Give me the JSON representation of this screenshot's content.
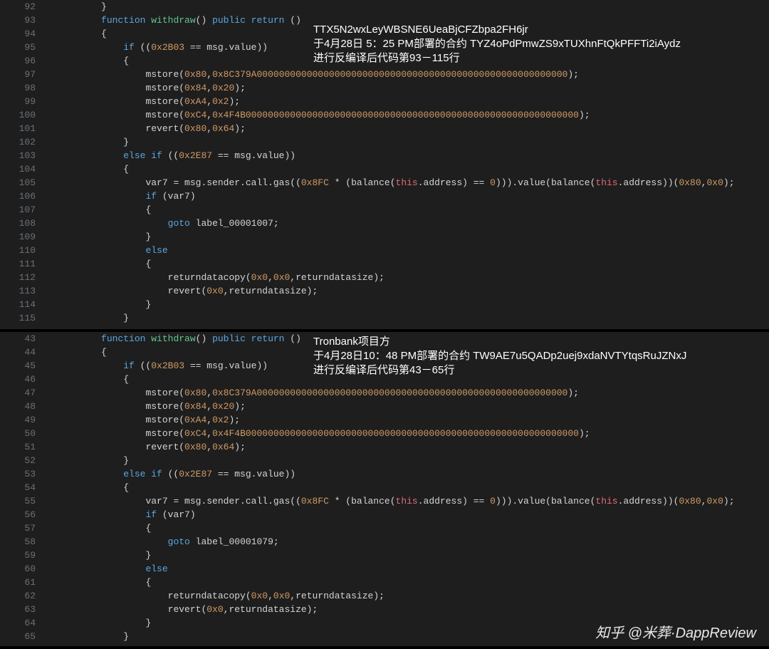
{
  "panel1": {
    "callout": {
      "line1": "TTX5N2wxLeyWBSNE6UeaBjCFZbpa2FH6jr",
      "line2": "于4月28日 5：25 PM部署的合约 TYZ4oPdPmwZS9xTUXhnFtQkPFFTi2iAydz",
      "line3": "进行反编译后代码第93－115行"
    },
    "start": 92,
    "lines": [
      {
        "n": 92,
        "i": 2,
        "t": [
          [
            "txt",
            "}"
          ]
        ]
      },
      {
        "n": 93,
        "i": 2,
        "t": [
          [
            "kw",
            "function "
          ],
          [
            "fn",
            "withdraw"
          ],
          [
            "txt",
            "() "
          ],
          [
            "kw",
            "public return"
          ],
          [
            "txt",
            " ()"
          ]
        ]
      },
      {
        "n": 94,
        "i": 2,
        "t": [
          [
            "txt",
            "{"
          ]
        ]
      },
      {
        "n": 95,
        "i": 3,
        "t": [
          [
            "kw",
            "if"
          ],
          [
            "txt",
            " (("
          ],
          [
            "num",
            "0x2B03"
          ],
          [
            "txt",
            " == msg.value))"
          ]
        ]
      },
      {
        "n": 96,
        "i": 3,
        "t": [
          [
            "txt",
            "{"
          ]
        ]
      },
      {
        "n": 97,
        "i": 4,
        "t": [
          [
            "txt",
            "mstore("
          ],
          [
            "num",
            "0x80"
          ],
          [
            "txt",
            ","
          ],
          [
            "num",
            "0x8C379A00000000000000000000000000000000000000000000000000000000"
          ],
          [
            "txt",
            ");"
          ]
        ]
      },
      {
        "n": 98,
        "i": 4,
        "t": [
          [
            "txt",
            "mstore("
          ],
          [
            "num",
            "0x84"
          ],
          [
            "txt",
            ","
          ],
          [
            "num",
            "0x20"
          ],
          [
            "txt",
            ");"
          ]
        ]
      },
      {
        "n": 99,
        "i": 4,
        "t": [
          [
            "txt",
            "mstore("
          ],
          [
            "num",
            "0xA4"
          ],
          [
            "txt",
            ","
          ],
          [
            "num",
            "0x2"
          ],
          [
            "txt",
            ");"
          ]
        ]
      },
      {
        "n": 100,
        "i": 4,
        "t": [
          [
            "txt",
            "mstore("
          ],
          [
            "num",
            "0xC4"
          ],
          [
            "txt",
            ","
          ],
          [
            "num",
            "0x4F4B000000000000000000000000000000000000000000000000000000000000"
          ],
          [
            "txt",
            ");"
          ]
        ]
      },
      {
        "n": 101,
        "i": 4,
        "t": [
          [
            "txt",
            "revert("
          ],
          [
            "num",
            "0x80"
          ],
          [
            "txt",
            ","
          ],
          [
            "num",
            "0x64"
          ],
          [
            "txt",
            ");"
          ]
        ]
      },
      {
        "n": 102,
        "i": 3,
        "t": [
          [
            "txt",
            "}"
          ]
        ]
      },
      {
        "n": 103,
        "i": 3,
        "t": [
          [
            "kw",
            "else if"
          ],
          [
            "txt",
            " (("
          ],
          [
            "num",
            "0x2E87"
          ],
          [
            "txt",
            " == msg.value))"
          ]
        ]
      },
      {
        "n": 104,
        "i": 3,
        "t": [
          [
            "txt",
            "{"
          ]
        ]
      },
      {
        "n": 105,
        "i": 4,
        "t": [
          [
            "txt",
            "var7 = msg.sender.call.gas(("
          ],
          [
            "num",
            "0x8FC"
          ],
          [
            "txt",
            " * (balance("
          ],
          [
            "prop",
            "this"
          ],
          [
            "txt",
            ".address) == "
          ],
          [
            "num",
            "0"
          ],
          [
            "txt",
            "))).value(balance("
          ],
          [
            "prop",
            "this"
          ],
          [
            "txt",
            ".address))("
          ],
          [
            "num",
            "0x80"
          ],
          [
            "txt",
            ","
          ],
          [
            "num",
            "0x0"
          ],
          [
            "txt",
            ");"
          ]
        ]
      },
      {
        "n": 106,
        "i": 4,
        "t": [
          [
            "kw",
            "if"
          ],
          [
            "txt",
            " (var7)"
          ]
        ]
      },
      {
        "n": 107,
        "i": 4,
        "t": [
          [
            "txt",
            "{"
          ]
        ]
      },
      {
        "n": 108,
        "i": 5,
        "t": [
          [
            "kw",
            "goto"
          ],
          [
            "txt",
            " label_00001007;"
          ]
        ]
      },
      {
        "n": 109,
        "i": 4,
        "t": [
          [
            "txt",
            "}"
          ]
        ]
      },
      {
        "n": 110,
        "i": 4,
        "t": [
          [
            "kw",
            "else"
          ]
        ]
      },
      {
        "n": 111,
        "i": 4,
        "t": [
          [
            "txt",
            "{"
          ]
        ]
      },
      {
        "n": 112,
        "i": 5,
        "t": [
          [
            "txt",
            "returndatacopy("
          ],
          [
            "num",
            "0x0"
          ],
          [
            "txt",
            ","
          ],
          [
            "num",
            "0x0"
          ],
          [
            "txt",
            ",returndatasize);"
          ]
        ]
      },
      {
        "n": 113,
        "i": 5,
        "t": [
          [
            "txt",
            "revert("
          ],
          [
            "num",
            "0x0"
          ],
          [
            "txt",
            ",returndatasize);"
          ]
        ]
      },
      {
        "n": 114,
        "i": 4,
        "t": [
          [
            "txt",
            "}"
          ]
        ]
      },
      {
        "n": 115,
        "i": 3,
        "t": [
          [
            "txt",
            "}"
          ]
        ]
      }
    ]
  },
  "panel2": {
    "callout": {
      "line1": "Tronbank项目方",
      "line2": "于4月28日10：48 PM部署的合约 TW9AE7u5QADp2uej9xdaNVTYtqsRuJZNxJ",
      "line3": "进行反编译后代码第43－65行"
    },
    "start": 43,
    "lines": [
      {
        "n": 43,
        "i": 2,
        "t": [
          [
            "kw",
            "function "
          ],
          [
            "fn",
            "withdraw"
          ],
          [
            "txt",
            "() "
          ],
          [
            "kw",
            "public return"
          ],
          [
            "txt",
            " ()"
          ]
        ]
      },
      {
        "n": 44,
        "i": 2,
        "t": [
          [
            "txt",
            "{"
          ]
        ]
      },
      {
        "n": 45,
        "i": 3,
        "t": [
          [
            "kw",
            "if"
          ],
          [
            "txt",
            " (("
          ],
          [
            "num",
            "0x2B03"
          ],
          [
            "txt",
            " == msg.value))"
          ]
        ]
      },
      {
        "n": 46,
        "i": 3,
        "t": [
          [
            "txt",
            "{"
          ]
        ]
      },
      {
        "n": 47,
        "i": 4,
        "t": [
          [
            "txt",
            "mstore("
          ],
          [
            "num",
            "0x80"
          ],
          [
            "txt",
            ","
          ],
          [
            "num",
            "0x8C379A00000000000000000000000000000000000000000000000000000000"
          ],
          [
            "txt",
            ");"
          ]
        ]
      },
      {
        "n": 48,
        "i": 4,
        "t": [
          [
            "txt",
            "mstore("
          ],
          [
            "num",
            "0x84"
          ],
          [
            "txt",
            ","
          ],
          [
            "num",
            "0x20"
          ],
          [
            "txt",
            ");"
          ]
        ]
      },
      {
        "n": 49,
        "i": 4,
        "t": [
          [
            "txt",
            "mstore("
          ],
          [
            "num",
            "0xA4"
          ],
          [
            "txt",
            ","
          ],
          [
            "num",
            "0x2"
          ],
          [
            "txt",
            ");"
          ]
        ]
      },
      {
        "n": 50,
        "i": 4,
        "t": [
          [
            "txt",
            "mstore("
          ],
          [
            "num",
            "0xC4"
          ],
          [
            "txt",
            ","
          ],
          [
            "num",
            "0x4F4B000000000000000000000000000000000000000000000000000000000000"
          ],
          [
            "txt",
            ");"
          ]
        ]
      },
      {
        "n": 51,
        "i": 4,
        "t": [
          [
            "txt",
            "revert("
          ],
          [
            "num",
            "0x80"
          ],
          [
            "txt",
            ","
          ],
          [
            "num",
            "0x64"
          ],
          [
            "txt",
            ");"
          ]
        ]
      },
      {
        "n": 52,
        "i": 3,
        "t": [
          [
            "txt",
            "}"
          ]
        ]
      },
      {
        "n": 53,
        "i": 3,
        "t": [
          [
            "kw",
            "else if"
          ],
          [
            "txt",
            " (("
          ],
          [
            "num",
            "0x2E87"
          ],
          [
            "txt",
            " == msg.value))"
          ]
        ]
      },
      {
        "n": 54,
        "i": 3,
        "t": [
          [
            "txt",
            "{"
          ]
        ]
      },
      {
        "n": 55,
        "i": 4,
        "t": [
          [
            "txt",
            "var7 = msg.sender.call.gas(("
          ],
          [
            "num",
            "0x8FC"
          ],
          [
            "txt",
            " * (balance("
          ],
          [
            "prop",
            "this"
          ],
          [
            "txt",
            ".address) == "
          ],
          [
            "num",
            "0"
          ],
          [
            "txt",
            "))).value(balance("
          ],
          [
            "prop",
            "this"
          ],
          [
            "txt",
            ".address))("
          ],
          [
            "num",
            "0x80"
          ],
          [
            "txt",
            ","
          ],
          [
            "num",
            "0x0"
          ],
          [
            "txt",
            ");"
          ]
        ]
      },
      {
        "n": 56,
        "i": 4,
        "t": [
          [
            "kw",
            "if"
          ],
          [
            "txt",
            " (var7)"
          ]
        ]
      },
      {
        "n": 57,
        "i": 4,
        "t": [
          [
            "txt",
            "{"
          ]
        ]
      },
      {
        "n": 58,
        "i": 5,
        "t": [
          [
            "kw",
            "goto"
          ],
          [
            "txt",
            " label_00001079;"
          ]
        ]
      },
      {
        "n": 59,
        "i": 4,
        "t": [
          [
            "txt",
            "}"
          ]
        ]
      },
      {
        "n": 60,
        "i": 4,
        "t": [
          [
            "kw",
            "else"
          ]
        ]
      },
      {
        "n": 61,
        "i": 4,
        "t": [
          [
            "txt",
            "{"
          ]
        ]
      },
      {
        "n": 62,
        "i": 5,
        "t": [
          [
            "txt",
            "returndatacopy("
          ],
          [
            "num",
            "0x0"
          ],
          [
            "txt",
            ","
          ],
          [
            "num",
            "0x0"
          ],
          [
            "txt",
            ",returndatasize);"
          ]
        ]
      },
      {
        "n": 63,
        "i": 5,
        "t": [
          [
            "txt",
            "revert("
          ],
          [
            "num",
            "0x0"
          ],
          [
            "txt",
            ",returndatasize);"
          ]
        ]
      },
      {
        "n": 64,
        "i": 4,
        "t": [
          [
            "txt",
            "}"
          ]
        ]
      },
      {
        "n": 65,
        "i": 3,
        "t": [
          [
            "txt",
            "}"
          ]
        ]
      }
    ]
  },
  "watermark": "知乎 @米葬·DappReview"
}
